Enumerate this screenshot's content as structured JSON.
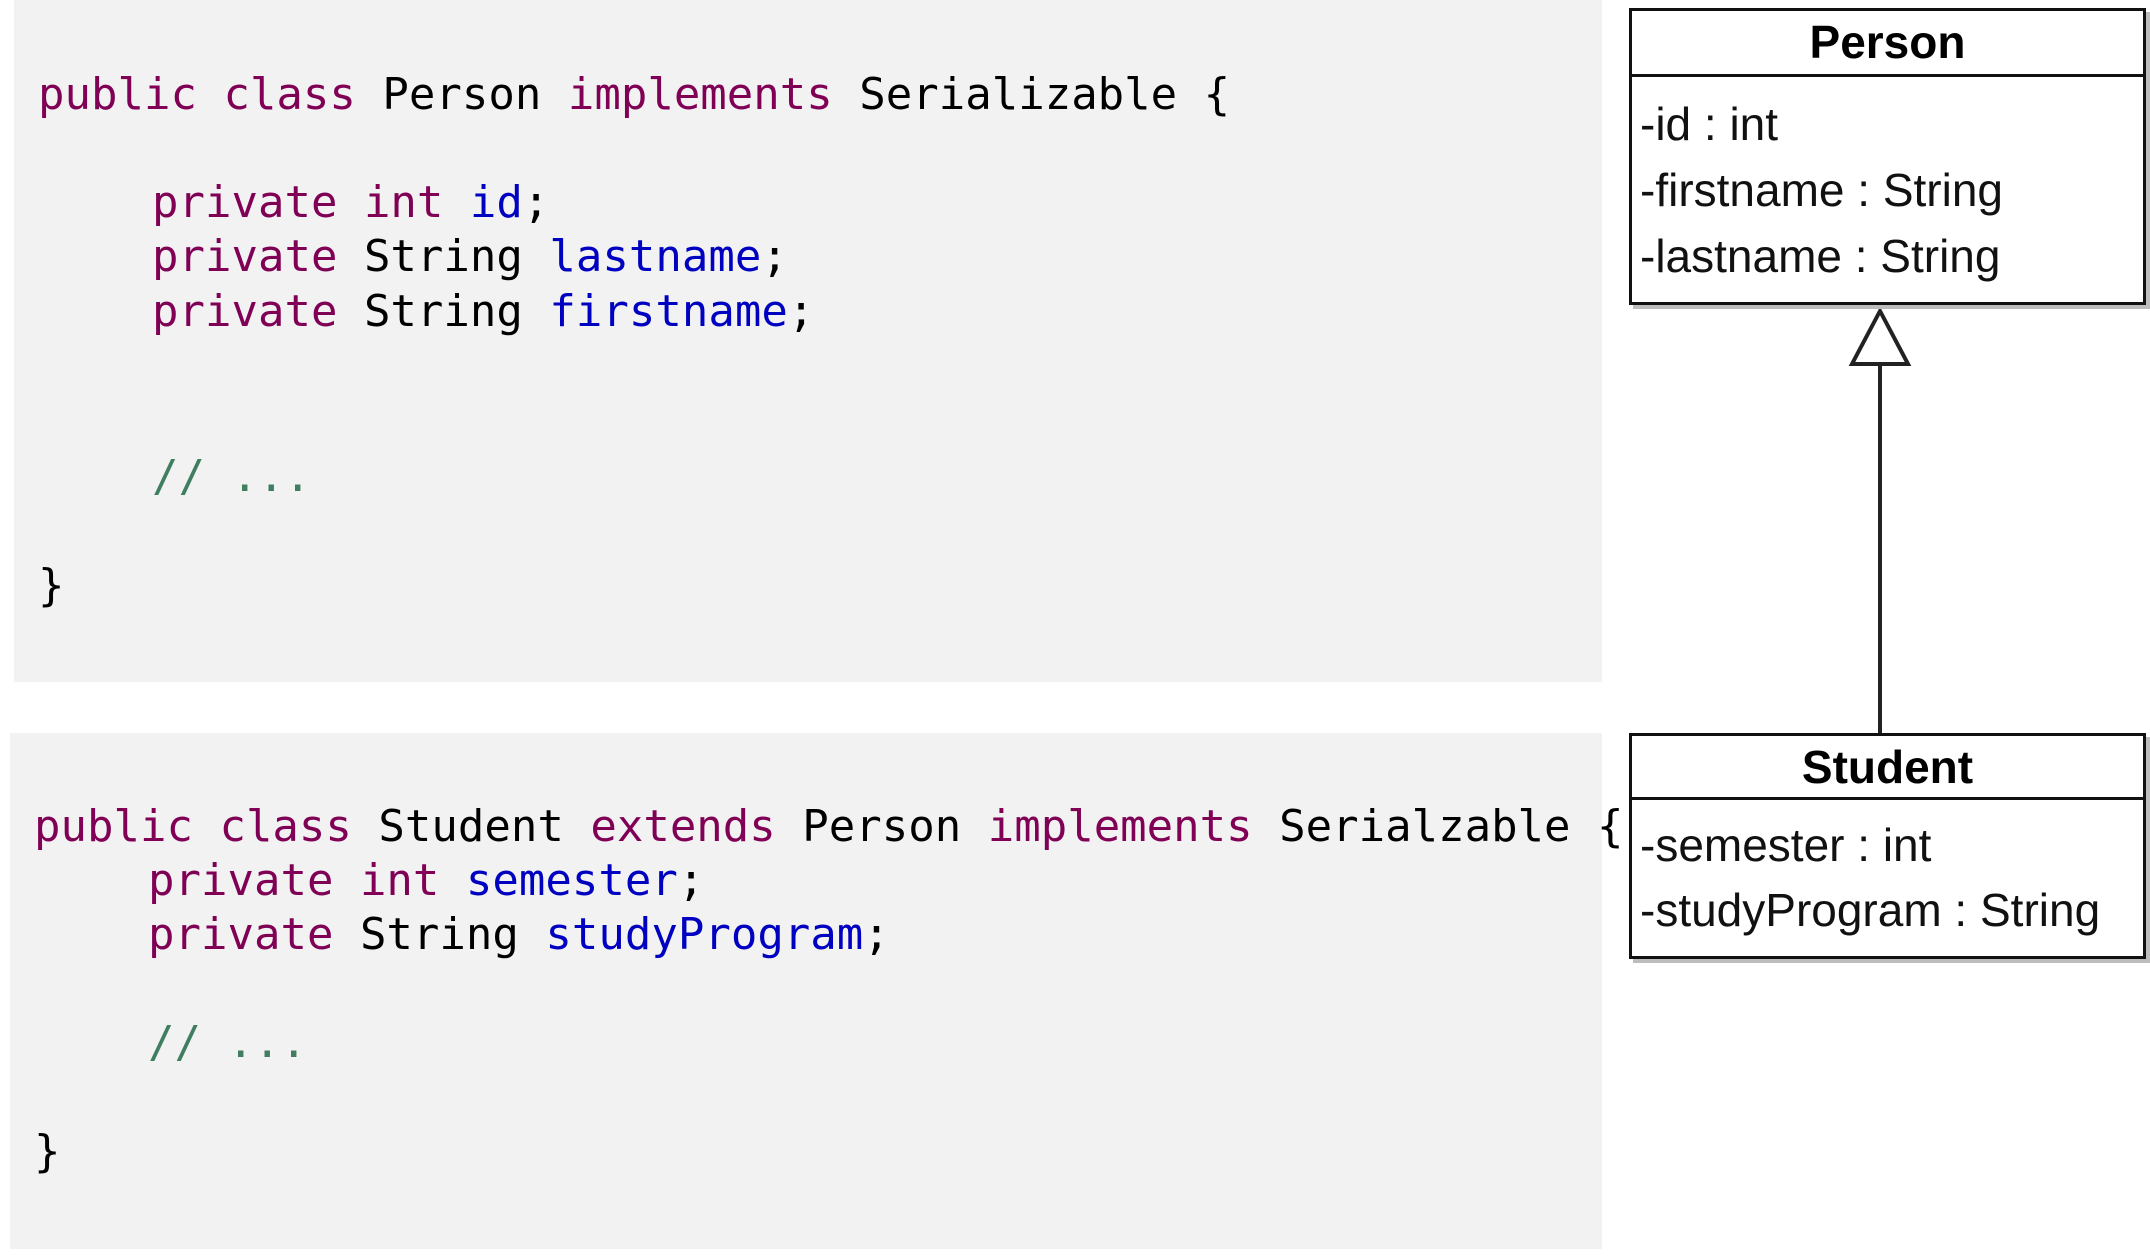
{
  "code_snippets": {
    "person_class": {
      "line1": {
        "kw_public": "public",
        "kw_class": "class",
        "class_name": "Person",
        "kw_implements": "implements",
        "interface_name": "Serializable",
        "open_brace": "{"
      },
      "fields": [
        {
          "modifier": "private",
          "type": "int",
          "name": "id",
          "terminator": ";"
        },
        {
          "modifier": "private",
          "type": "String",
          "name": "lastname",
          "terminator": ";"
        },
        {
          "modifier": "private",
          "type": "String",
          "name": "firstname",
          "terminator": ";"
        }
      ],
      "comment": "// ...",
      "close_brace": "}"
    },
    "student_class": {
      "line1": {
        "kw_public": "public",
        "kw_class": "class",
        "class_name": "Student",
        "kw_extends": "extends",
        "parent_name": "Person",
        "kw_implements": "implements",
        "interface_name": "Serialzable",
        "open_brace": "{"
      },
      "fields": [
        {
          "modifier": "private",
          "type": "int",
          "name": "semester",
          "terminator": ";"
        },
        {
          "modifier": "private",
          "type": "String",
          "name": "studyProgram",
          "terminator": ";"
        }
      ],
      "comment": "// ...",
      "close_brace": "}"
    }
  },
  "uml": {
    "person": {
      "title": "Person",
      "attributes": [
        "-id : int",
        "-firstname : String",
        "-lastname : String"
      ]
    },
    "student": {
      "title": "Student",
      "attributes": [
        "-semester : int",
        "-studyProgram : String"
      ]
    },
    "relationship": "generalization"
  },
  "colors": {
    "keyword": "#7f0055",
    "field": "#0000c0",
    "comment": "#3f7f5f",
    "code_background": "#f2f2f2"
  }
}
